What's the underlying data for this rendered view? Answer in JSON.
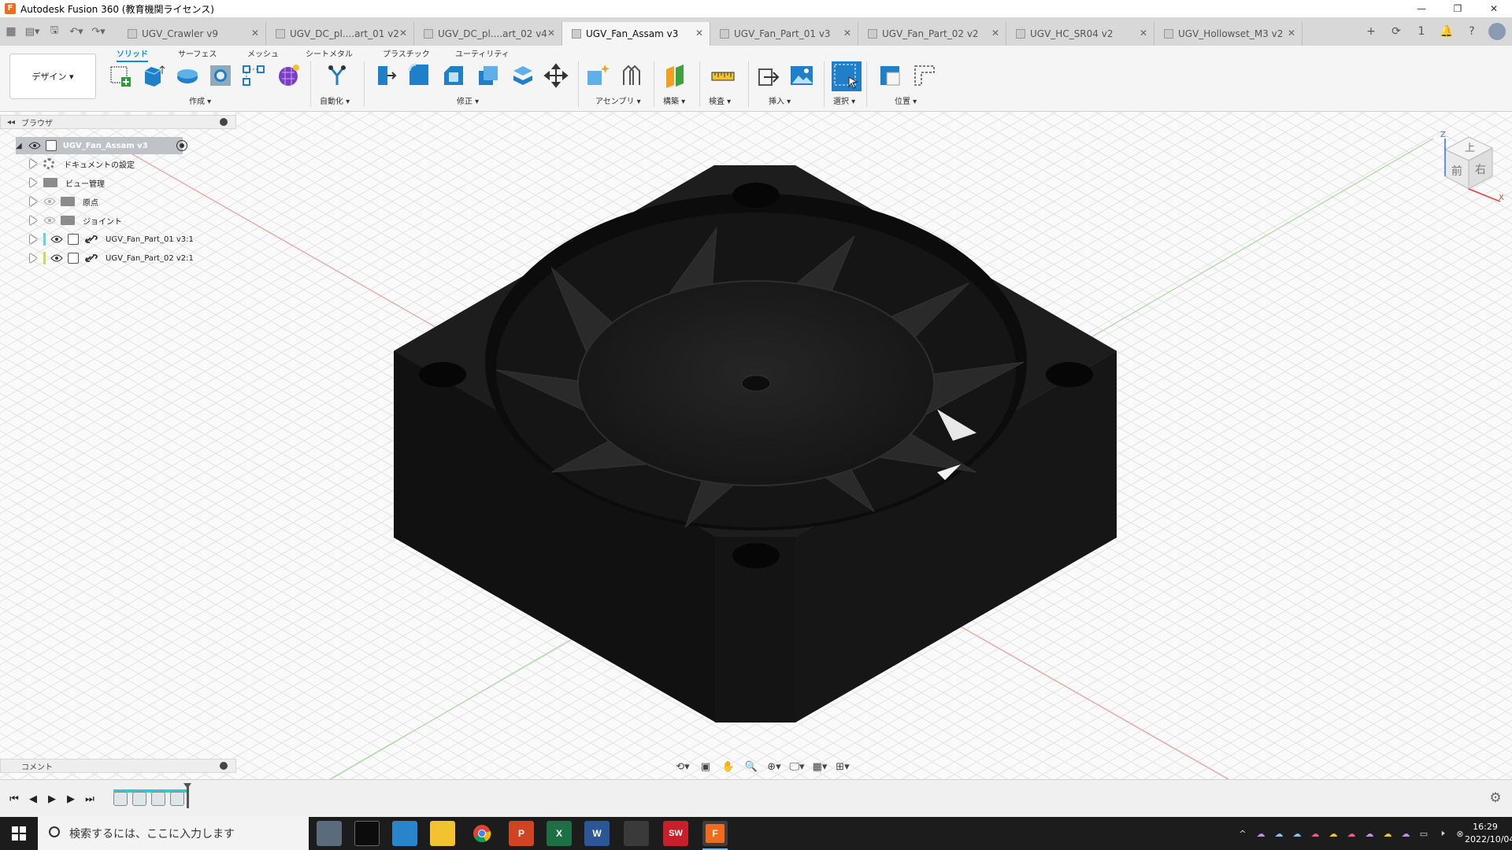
{
  "window": {
    "title": "Autodesk Fusion 360 (教育機関ライセンス)",
    "app_icon_letter": "F",
    "controls": [
      "—",
      "❐",
      "✕"
    ]
  },
  "tabs": [
    {
      "label": "UGV_Crawler v9",
      "active": false
    },
    {
      "label": "UGV_DC_pl....art_01 v2",
      "active": false
    },
    {
      "label": "UGV_DC_pl....art_02 v4",
      "active": false
    },
    {
      "label": "UGV_Fan_Assam v3",
      "active": true
    },
    {
      "label": "UGV_Fan_Part_01 v3",
      "active": false
    },
    {
      "label": "UGV_Fan_Part_02 v2",
      "active": false
    },
    {
      "label": "UGV_HC_SR04 v2",
      "active": false
    },
    {
      "label": "UGV_Hollowset_M3 v2",
      "active": false
    }
  ],
  "tabbar_right": {
    "add": "+",
    "online": "⟳",
    "jobs": "1",
    "notify": "🔔",
    "help": "?"
  },
  "ribbon": {
    "workspace": "デザイン ▾",
    "tabs": [
      "ソリッド",
      "サーフェス",
      "メッシュ",
      "シートメタル",
      "プラスチック",
      "ユーティリティ"
    ],
    "groups": {
      "create": "作成 ▾",
      "automate": "自動化 ▾",
      "modify": "修正 ▾",
      "assemble": "アセンブリ ▾",
      "construct": "構築 ▾",
      "inspect": "検査 ▾",
      "insert": "挿入 ▾",
      "select": "選択 ▾",
      "position": "位置 ▾"
    }
  },
  "browser": {
    "title": "ブラウザ",
    "root": "UGV_Fan_Assam v3",
    "items": [
      {
        "label": "ドキュメントの設定"
      },
      {
        "label": "ビュー管理"
      },
      {
        "label": "原点"
      },
      {
        "label": "ジョイント"
      },
      {
        "label": "UGV_Fan_Part_01 v3:1",
        "color": "#5fd3e0"
      },
      {
        "label": "UGV_Fan_Part_02 v2:1",
        "color": "#c6e04a"
      }
    ]
  },
  "viewcube": {
    "top": "上",
    "front": "前",
    "right": "右",
    "axis_z": "Z",
    "axis_x": "X"
  },
  "comment": {
    "title": "コメント"
  },
  "taskbar": {
    "search_placeholder": "検索するには、ここに入力します",
    "apps": [
      "explorer-window",
      "terminal",
      "notepad",
      "file-explorer",
      "chrome",
      "powerpoint",
      "excel",
      "word",
      "game",
      "solidworks",
      "fusion"
    ],
    "app_letters": {
      "powerpoint": "P",
      "excel": "X",
      "word": "W",
      "solidworks": "SW",
      "fusion": "F"
    },
    "time": "16:29",
    "date": "2022/10/04"
  }
}
